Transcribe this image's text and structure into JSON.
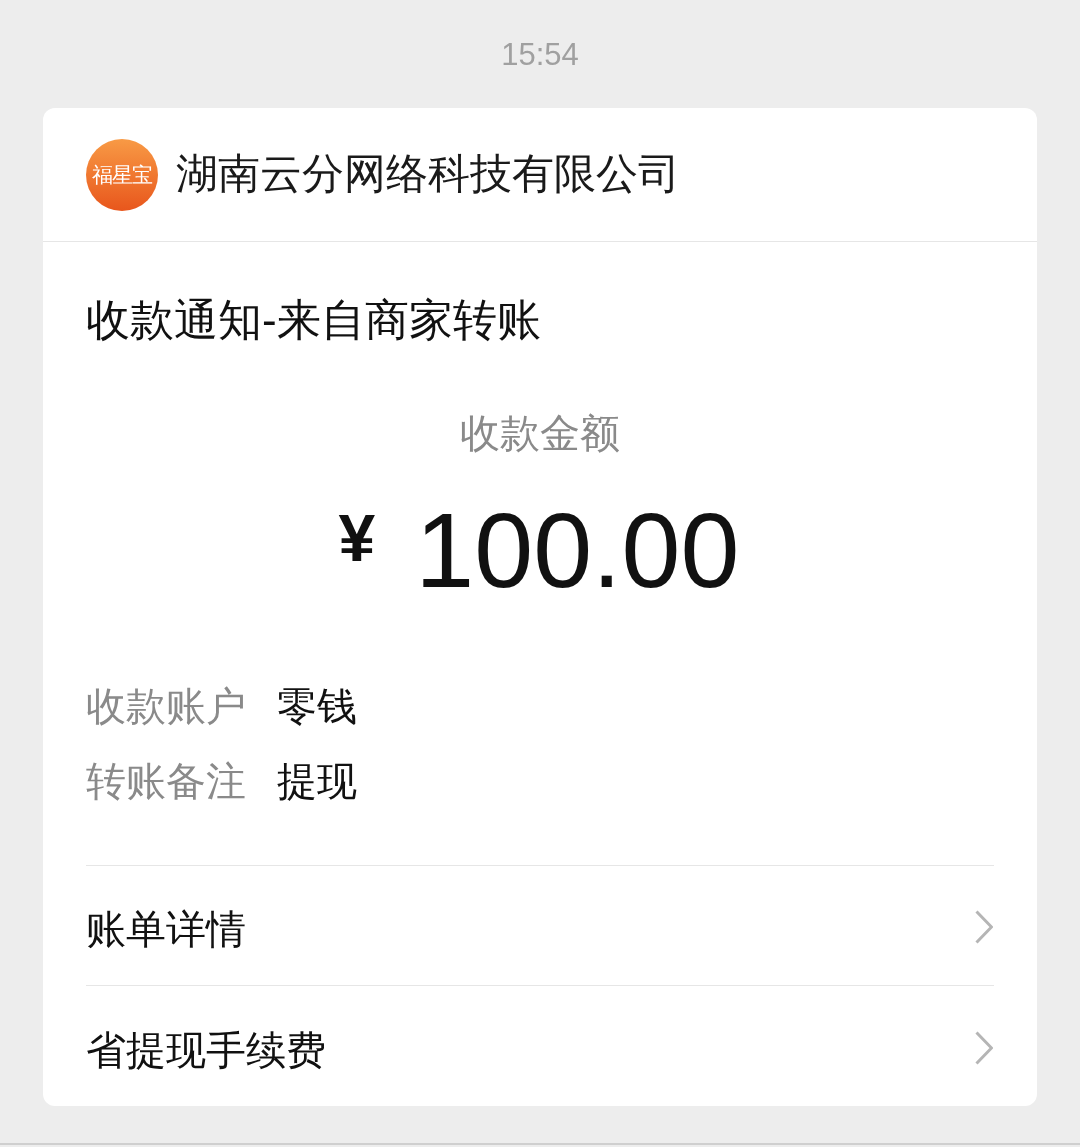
{
  "time": "15:54",
  "card": {
    "merchant": {
      "logo_text": "福星宝",
      "name": "湖南云分网络科技有限公司"
    },
    "title": "收款通知-来自商家转账",
    "amount": {
      "label": "收款金额",
      "currency": "¥",
      "value": "100.00"
    },
    "details": [
      {
        "label": "收款账户",
        "value": "零钱"
      },
      {
        "label": "转账备注",
        "value": "提现"
      }
    ],
    "links": [
      {
        "label": "账单详情"
      },
      {
        "label": "省提现手续费"
      }
    ]
  }
}
